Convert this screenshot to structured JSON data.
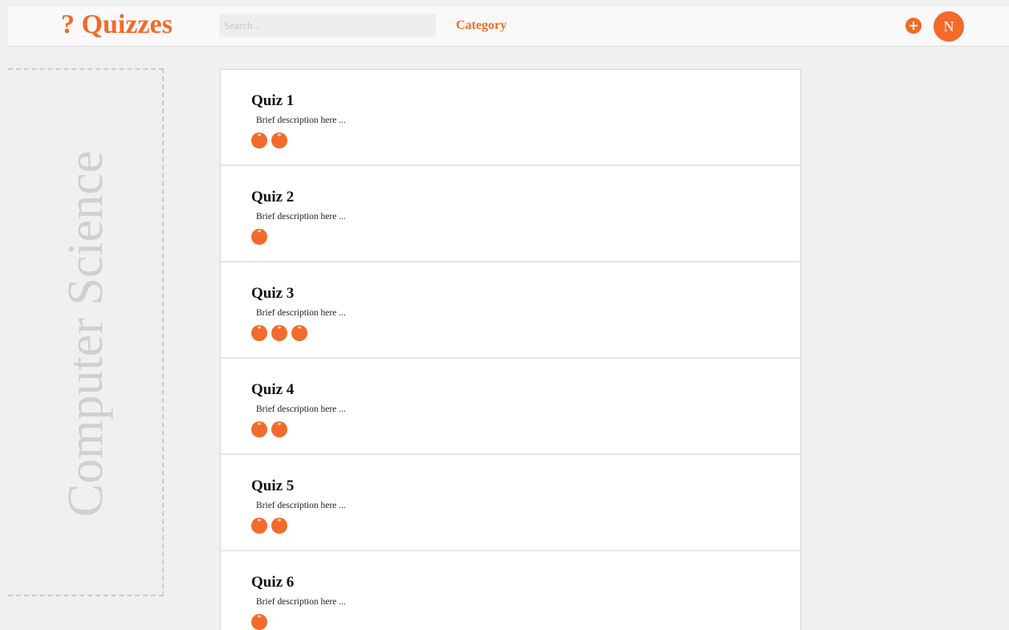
{
  "header": {
    "logo_text": "? Quizzes",
    "search_placeholder": "Search ..",
    "category_label": "Category",
    "add_icon": "plus-circle-icon",
    "avatar_initial": "N"
  },
  "sidebar": {
    "category_title": "Computer Science"
  },
  "quizzes": [
    {
      "title": "Quiz 1",
      "description": "Brief description here ...",
      "badge_count": 2
    },
    {
      "title": "Quiz 2",
      "description": "Brief description here ...",
      "badge_count": 1
    },
    {
      "title": "Quiz 3",
      "description": "Brief description here ...",
      "badge_count": 3
    },
    {
      "title": "Quiz 4",
      "description": "Brief description here ...",
      "badge_count": 2
    },
    {
      "title": "Quiz 5",
      "description": "Brief description here ...",
      "badge_count": 2
    },
    {
      "title": "Quiz 6",
      "description": "Brief description here ...",
      "badge_count": 1
    }
  ],
  "badge_symbol": "*",
  "colors": {
    "accent": "#f26b2a",
    "background": "#f0f0f0",
    "card": "#ffffff",
    "sidebar_text": "#d0d0d0"
  }
}
